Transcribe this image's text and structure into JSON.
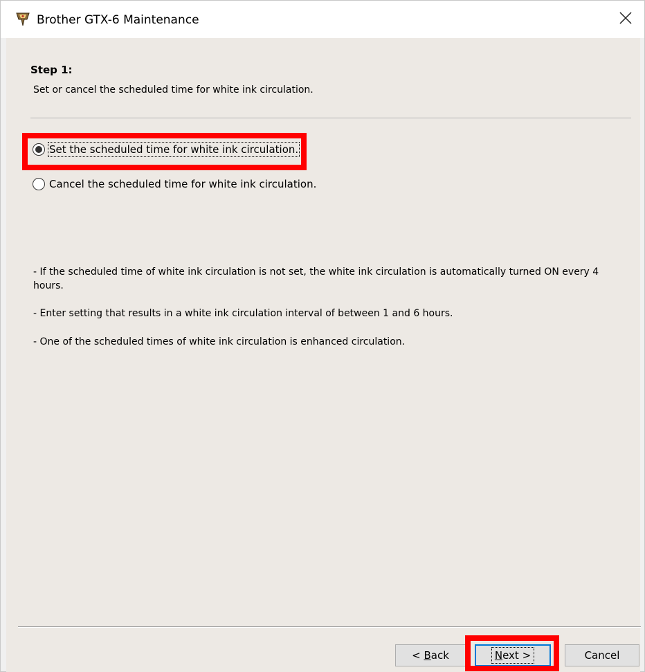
{
  "window": {
    "title": "Brother GTX-6 Maintenance",
    "app_icon": "brother-gtx-icon",
    "close_icon": "close-icon"
  },
  "step": {
    "title": "Step 1:",
    "description": "Set or cancel the scheduled time for white ink circulation."
  },
  "options": [
    {
      "label": "Set the scheduled time for white ink circulation.",
      "checked": true
    },
    {
      "label": "Cancel the scheduled time for white ink circulation.",
      "checked": false
    }
  ],
  "notes": [
    "- If the scheduled time of white ink circulation is not set, the white ink circulation is automatically turned ON every 4 hours.",
    "- Enter setting that results in a white ink circulation interval of between 1 and 6 hours.",
    "- One of the scheduled times of white ink circulation is enhanced circulation."
  ],
  "buttons": {
    "back": {
      "prefix": "< ",
      "accel": "B",
      "rest": "ack"
    },
    "next": {
      "accel": "N",
      "rest": "ext >"
    },
    "cancel": "Cancel"
  },
  "colors": {
    "highlight": "#ff0000",
    "default_button_border": "#0078d7",
    "dialog_background": "#ede9e4"
  }
}
